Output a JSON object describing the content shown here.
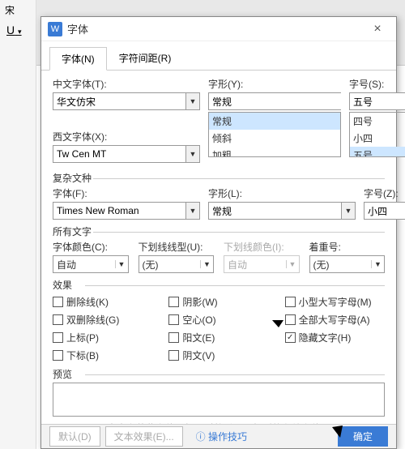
{
  "background": {
    "font_sample": "宋",
    "underline_btn": "U"
  },
  "dialog": {
    "icon_letter": "W",
    "title": "字体",
    "close": "×",
    "tabs": {
      "font": "字体(N)",
      "spacing": "字符间距(R)"
    },
    "cn_font": {
      "label": "中文字体(T):",
      "value": "华文仿宋"
    },
    "style": {
      "label": "字形(Y):",
      "value": "常规",
      "options": [
        "常规",
        "倾斜",
        "加粗"
      ]
    },
    "size": {
      "label": "字号(S):",
      "value": "五号",
      "options": [
        "四号",
        "小四",
        "五号"
      ]
    },
    "west_font": {
      "label": "西文字体(X):",
      "value": "Tw Cen MT"
    },
    "complex_group": "复杂文种",
    "complex_font": {
      "label": "字体(F):",
      "value": "Times New Roman"
    },
    "complex_style": {
      "label": "字形(L):",
      "value": "常规"
    },
    "complex_size": {
      "label": "字号(Z):",
      "value": "小四"
    },
    "all_text_group": "所有文字",
    "font_color": {
      "label": "字体颜色(C):",
      "value": "自动"
    },
    "underline_style": {
      "label": "下划线线型(U):",
      "value": "(无)"
    },
    "underline_color": {
      "label": "下划线颜色(I):",
      "value": "自动"
    },
    "emphasis": {
      "label": "着重号:",
      "value": "(无)"
    },
    "effects_group": "效果",
    "effects": {
      "strike": "删除线(K)",
      "dstrike": "双删除线(G)",
      "sup": "上标(P)",
      "sub": "下标(B)",
      "shadow": "阴影(W)",
      "hollow": "空心(O)",
      "emboss": "阳文(E)",
      "engrave": "阴文(V)",
      "smallcaps": "小型大写字母(M)",
      "allcaps": "全部大写字母(A)",
      "hidden": "隐藏文字(H)"
    },
    "hidden_checked": true,
    "preview_group": "预览",
    "note": "尚未安装此字体，打印时将采用最相近的有效字体。",
    "footer": {
      "default": "默认(D)",
      "texteffect": "文本效果(E)...",
      "tips": "操作技巧",
      "ok": "确定"
    }
  }
}
